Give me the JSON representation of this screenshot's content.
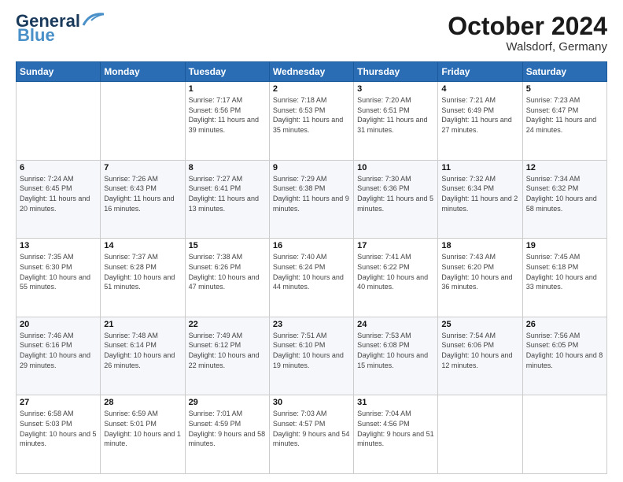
{
  "header": {
    "logo_line1": "General",
    "logo_line2": "Blue",
    "month_title": "October 2024",
    "location": "Walsdorf, Germany"
  },
  "weekdays": [
    "Sunday",
    "Monday",
    "Tuesday",
    "Wednesday",
    "Thursday",
    "Friday",
    "Saturday"
  ],
  "weeks": [
    [
      {
        "day": "",
        "info": ""
      },
      {
        "day": "",
        "info": ""
      },
      {
        "day": "1",
        "info": "Sunrise: 7:17 AM\nSunset: 6:56 PM\nDaylight: 11 hours and 39 minutes."
      },
      {
        "day": "2",
        "info": "Sunrise: 7:18 AM\nSunset: 6:53 PM\nDaylight: 11 hours and 35 minutes."
      },
      {
        "day": "3",
        "info": "Sunrise: 7:20 AM\nSunset: 6:51 PM\nDaylight: 11 hours and 31 minutes."
      },
      {
        "day": "4",
        "info": "Sunrise: 7:21 AM\nSunset: 6:49 PM\nDaylight: 11 hours and 27 minutes."
      },
      {
        "day": "5",
        "info": "Sunrise: 7:23 AM\nSunset: 6:47 PM\nDaylight: 11 hours and 24 minutes."
      }
    ],
    [
      {
        "day": "6",
        "info": "Sunrise: 7:24 AM\nSunset: 6:45 PM\nDaylight: 11 hours and 20 minutes."
      },
      {
        "day": "7",
        "info": "Sunrise: 7:26 AM\nSunset: 6:43 PM\nDaylight: 11 hours and 16 minutes."
      },
      {
        "day": "8",
        "info": "Sunrise: 7:27 AM\nSunset: 6:41 PM\nDaylight: 11 hours and 13 minutes."
      },
      {
        "day": "9",
        "info": "Sunrise: 7:29 AM\nSunset: 6:38 PM\nDaylight: 11 hours and 9 minutes."
      },
      {
        "day": "10",
        "info": "Sunrise: 7:30 AM\nSunset: 6:36 PM\nDaylight: 11 hours and 5 minutes."
      },
      {
        "day": "11",
        "info": "Sunrise: 7:32 AM\nSunset: 6:34 PM\nDaylight: 11 hours and 2 minutes."
      },
      {
        "day": "12",
        "info": "Sunrise: 7:34 AM\nSunset: 6:32 PM\nDaylight: 10 hours and 58 minutes."
      }
    ],
    [
      {
        "day": "13",
        "info": "Sunrise: 7:35 AM\nSunset: 6:30 PM\nDaylight: 10 hours and 55 minutes."
      },
      {
        "day": "14",
        "info": "Sunrise: 7:37 AM\nSunset: 6:28 PM\nDaylight: 10 hours and 51 minutes."
      },
      {
        "day": "15",
        "info": "Sunrise: 7:38 AM\nSunset: 6:26 PM\nDaylight: 10 hours and 47 minutes."
      },
      {
        "day": "16",
        "info": "Sunrise: 7:40 AM\nSunset: 6:24 PM\nDaylight: 10 hours and 44 minutes."
      },
      {
        "day": "17",
        "info": "Sunrise: 7:41 AM\nSunset: 6:22 PM\nDaylight: 10 hours and 40 minutes."
      },
      {
        "day": "18",
        "info": "Sunrise: 7:43 AM\nSunset: 6:20 PM\nDaylight: 10 hours and 36 minutes."
      },
      {
        "day": "19",
        "info": "Sunrise: 7:45 AM\nSunset: 6:18 PM\nDaylight: 10 hours and 33 minutes."
      }
    ],
    [
      {
        "day": "20",
        "info": "Sunrise: 7:46 AM\nSunset: 6:16 PM\nDaylight: 10 hours and 29 minutes."
      },
      {
        "day": "21",
        "info": "Sunrise: 7:48 AM\nSunset: 6:14 PM\nDaylight: 10 hours and 26 minutes."
      },
      {
        "day": "22",
        "info": "Sunrise: 7:49 AM\nSunset: 6:12 PM\nDaylight: 10 hours and 22 minutes."
      },
      {
        "day": "23",
        "info": "Sunrise: 7:51 AM\nSunset: 6:10 PM\nDaylight: 10 hours and 19 minutes."
      },
      {
        "day": "24",
        "info": "Sunrise: 7:53 AM\nSunset: 6:08 PM\nDaylight: 10 hours and 15 minutes."
      },
      {
        "day": "25",
        "info": "Sunrise: 7:54 AM\nSunset: 6:06 PM\nDaylight: 10 hours and 12 minutes."
      },
      {
        "day": "26",
        "info": "Sunrise: 7:56 AM\nSunset: 6:05 PM\nDaylight: 10 hours and 8 minutes."
      }
    ],
    [
      {
        "day": "27",
        "info": "Sunrise: 6:58 AM\nSunset: 5:03 PM\nDaylight: 10 hours and 5 minutes."
      },
      {
        "day": "28",
        "info": "Sunrise: 6:59 AM\nSunset: 5:01 PM\nDaylight: 10 hours and 1 minute."
      },
      {
        "day": "29",
        "info": "Sunrise: 7:01 AM\nSunset: 4:59 PM\nDaylight: 9 hours and 58 minutes."
      },
      {
        "day": "30",
        "info": "Sunrise: 7:03 AM\nSunset: 4:57 PM\nDaylight: 9 hours and 54 minutes."
      },
      {
        "day": "31",
        "info": "Sunrise: 7:04 AM\nSunset: 4:56 PM\nDaylight: 9 hours and 51 minutes."
      },
      {
        "day": "",
        "info": ""
      },
      {
        "day": "",
        "info": ""
      }
    ]
  ]
}
